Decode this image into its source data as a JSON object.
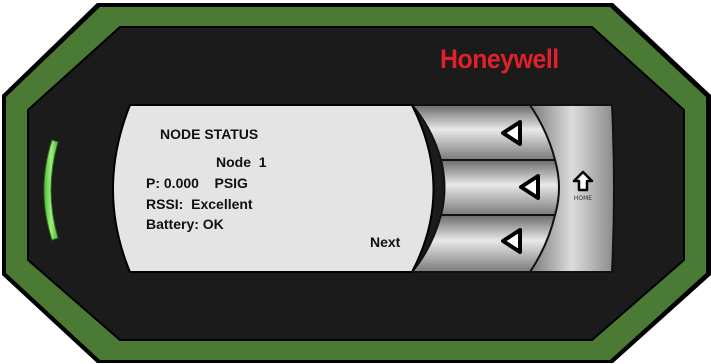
{
  "device": {
    "brand": "Honeywell",
    "brand_color": "#e0202a",
    "bezel_color": "#4a7a34",
    "status_led_color": "#6cd04a",
    "led_state": "on"
  },
  "screen": {
    "title": "NODE STATUS",
    "node_label": "Node  1",
    "pressure": "P: 0.000    PSIG",
    "rssi": "RSSI:  Excellent",
    "battery": "Battery: OK",
    "softkey_label": "Next"
  },
  "buttons": {
    "top": {
      "icon": "left-arrow-icon"
    },
    "middle": {
      "icon": "left-arrow-icon"
    },
    "bottom": {
      "icon": "left-arrow-icon"
    },
    "home": {
      "icon": "home-up-arrow-icon",
      "label": "HOME"
    }
  }
}
